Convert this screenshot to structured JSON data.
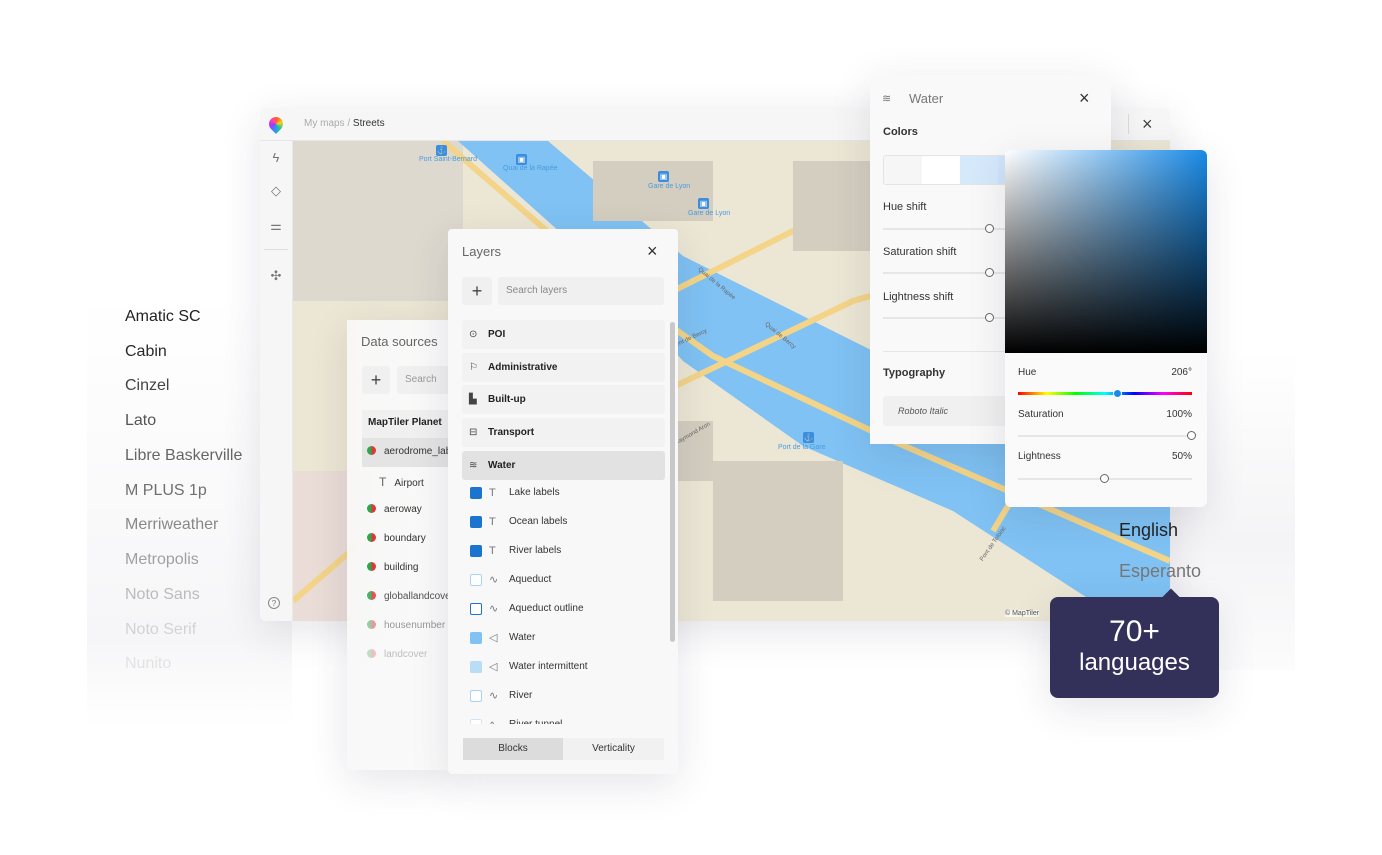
{
  "fonts": [
    "Amatic SC",
    "Cabin",
    "Cinzel",
    "Lato",
    "Libre Baskerville",
    "M PLUS 1p",
    "Merriweather",
    "Metropolis",
    "Noto Sans",
    "Noto Serif",
    "Nunito"
  ],
  "app": {
    "breadcrumb_root": "My maps",
    "breadcrumb_sep": "/",
    "breadcrumb_current": "Streets",
    "help": "?"
  },
  "map": {
    "labels": [
      "Port Saint-Bernard",
      "Quai de la Rapée",
      "Gare de Lyon",
      "Gare de Lyon",
      "Port de la Gare"
    ],
    "roads": [
      "Quai de la Rapée",
      "Pont de Bercy",
      "Quai de Bercy",
      "Raymond Aron",
      "Pont de Tolbiac"
    ],
    "attribution": "© MapTiler",
    "colors": {
      "water": "#7fc2f3",
      "land": "#ece6d4",
      "road": "#f3d488"
    }
  },
  "data_sources": {
    "title": "Data sources",
    "add": "+",
    "search_placeholder": "Search",
    "source": "MapTiler Planet",
    "rows": [
      "aerodrome_label",
      "Airport",
      "aeroway",
      "boundary",
      "building",
      "globallandcover",
      "housenumber",
      "landcover"
    ]
  },
  "layers": {
    "title": "Layers",
    "close": "×",
    "add": "+",
    "search_placeholder": "Search layers",
    "categories": [
      "POI",
      "Administrative",
      "Built-up",
      "Transport",
      "Water"
    ],
    "items": [
      {
        "label": "Lake labels",
        "type": "text",
        "color": "#1b74d0",
        "filled": true
      },
      {
        "label": "Ocean labels",
        "type": "text",
        "color": "#1b74d0",
        "filled": true
      },
      {
        "label": "River labels",
        "type": "text",
        "color": "#1b74d0",
        "filled": true
      },
      {
        "label": "Aqueduct",
        "type": "line",
        "color": "#a8d4f7",
        "filled": false
      },
      {
        "label": "Aqueduct outline",
        "type": "line",
        "color": "#1b74d0",
        "filled": false
      },
      {
        "label": "Water",
        "type": "fill",
        "color": "#7fc2f3",
        "filled": true
      },
      {
        "label": "Water intermittent",
        "type": "fill",
        "color": "#b9dcf7",
        "filled": true
      },
      {
        "label": "River",
        "type": "line",
        "color": "#a8d4f7",
        "filled": false
      },
      {
        "label": "River tunnel",
        "type": "line",
        "color": "#cfe6f9",
        "filled": false
      }
    ],
    "tabs": [
      "Blocks",
      "Verticality"
    ],
    "active_tab": "Blocks"
  },
  "water_panel": {
    "title": "Water",
    "close": "×",
    "colors_heading": "Colors",
    "hue_shift": "Hue shift",
    "saturation_shift": "Saturation shift",
    "lightness_shift": "Lightness shift",
    "typography_heading": "Typography",
    "font": "Roboto Italic",
    "swatches": [
      "#f6f6f6",
      "#ffffff",
      "#d6e9fb",
      "#cfe5fa",
      "#bcdcf8",
      "#a7d1f6"
    ]
  },
  "window_close": "×",
  "picker": {
    "hue_label": "Hue",
    "hue_value": "206°",
    "hue": 206,
    "saturation_label": "Saturation",
    "saturation_value": "100%",
    "saturation": 100,
    "lightness_label": "Lightness",
    "lightness_value": "50%",
    "lightness": 50
  },
  "languages": [
    "English",
    "Esperanto"
  ],
  "tooltip": {
    "count": "70+",
    "label": "languages",
    "bg": "#33315a"
  }
}
